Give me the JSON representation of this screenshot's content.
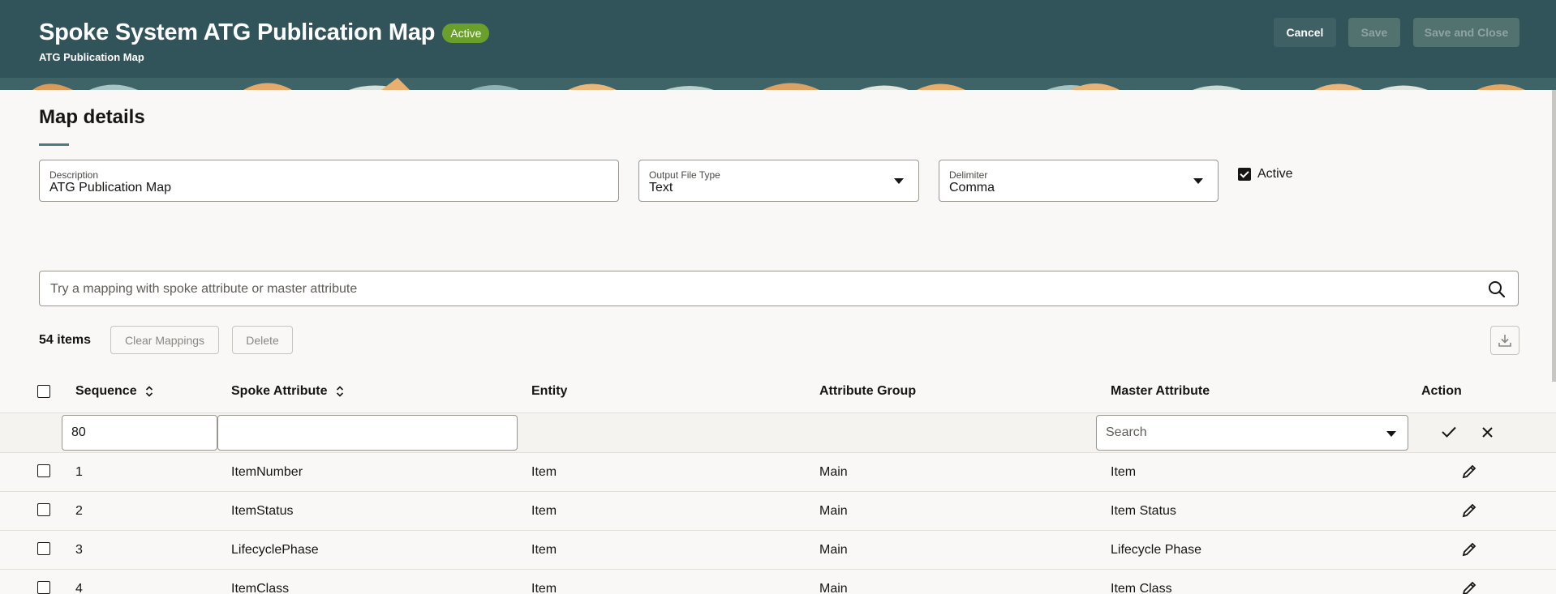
{
  "header": {
    "title": "Spoke System ATG Publication Map",
    "status_badge": "Active",
    "subtitle": "ATG Publication Map",
    "buttons": {
      "cancel": "Cancel",
      "save": "Save",
      "save_and_close": "Save and Close"
    }
  },
  "section": {
    "title": "Map details"
  },
  "fields": {
    "description": {
      "label": "Description",
      "value": "ATG Publication Map"
    },
    "output_file_type": {
      "label": "Output File Type",
      "value": "Text"
    },
    "delimiter": {
      "label": "Delimiter",
      "value": "Comma"
    },
    "active": {
      "label": "Active",
      "checked": true
    }
  },
  "search": {
    "placeholder": "Try a mapping with spoke attribute or master attribute"
  },
  "toolbar": {
    "items_count": "54 items",
    "clear_mappings": "Clear Mappings",
    "delete": "Delete"
  },
  "table": {
    "columns": [
      "Sequence",
      "Spoke Attribute",
      "Entity",
      "Attribute Group",
      "Master Attribute",
      "Action"
    ],
    "edit_row": {
      "sequence": "80",
      "spoke_attribute": "",
      "master_attribute_placeholder": "Search"
    },
    "rows": [
      {
        "sequence": "1",
        "spoke_attribute": "ItemNumber",
        "entity": "Item",
        "attribute_group": "Main",
        "master_attribute": "Item"
      },
      {
        "sequence": "2",
        "spoke_attribute": "ItemStatus",
        "entity": "Item",
        "attribute_group": "Main",
        "master_attribute": "Item Status"
      },
      {
        "sequence": "3",
        "spoke_attribute": "LifecyclePhase",
        "entity": "Item",
        "attribute_group": "Main",
        "master_attribute": "Lifecycle Phase"
      },
      {
        "sequence": "4",
        "spoke_attribute": "ItemClass",
        "entity": "Item",
        "attribute_group": "Main",
        "master_attribute": "Item Class"
      }
    ]
  },
  "colors": {
    "header_bg": "#31545a",
    "badge_bg": "#6b9f2b",
    "accent_underline": "#4a7b82"
  }
}
